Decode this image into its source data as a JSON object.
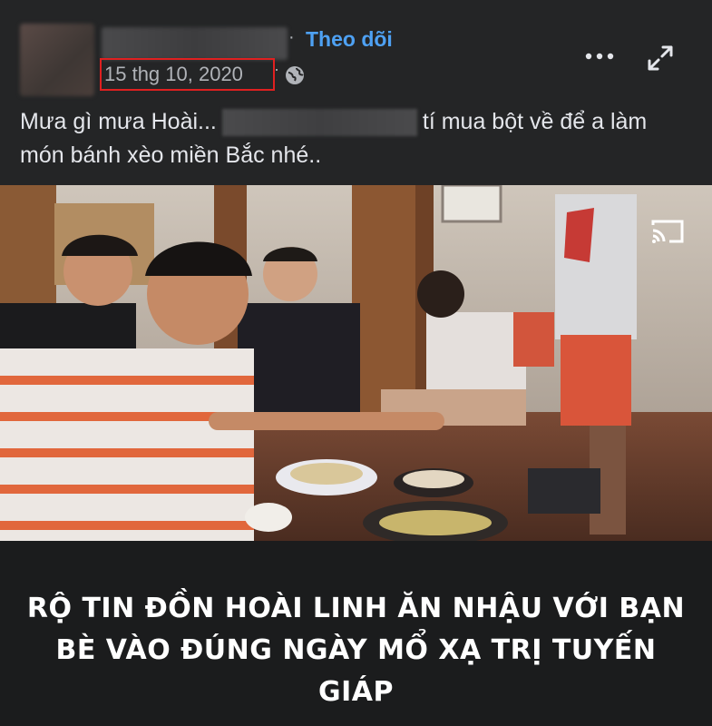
{
  "post": {
    "follow_label": "Theo dõi",
    "separator": "·",
    "date": "15 thg 10, 2020",
    "date_separator": "·",
    "caption_part1": "Mưa gì mưa Hoài...",
    "caption_part2": "tí mua bột về để a làm món bánh xèo miền Bắc nhé..",
    "icons": {
      "privacy": "globe-icon",
      "more": "more-options-icon",
      "expand": "expand-icon",
      "cast": "cast-icon"
    }
  },
  "banner": {
    "headline": "RỘ TIN ĐỒN HOÀI LINH ĂN NHẬU VỚI BẠN BÈ VÀO ĐÚNG NGÀY MỔ XẠ TRỊ TUYẾN GIÁP"
  },
  "colors": {
    "background": "#242526",
    "follow": "#4ea1f3",
    "date_highlight": "#e02020",
    "banner_bg": "#1b1c1d"
  }
}
